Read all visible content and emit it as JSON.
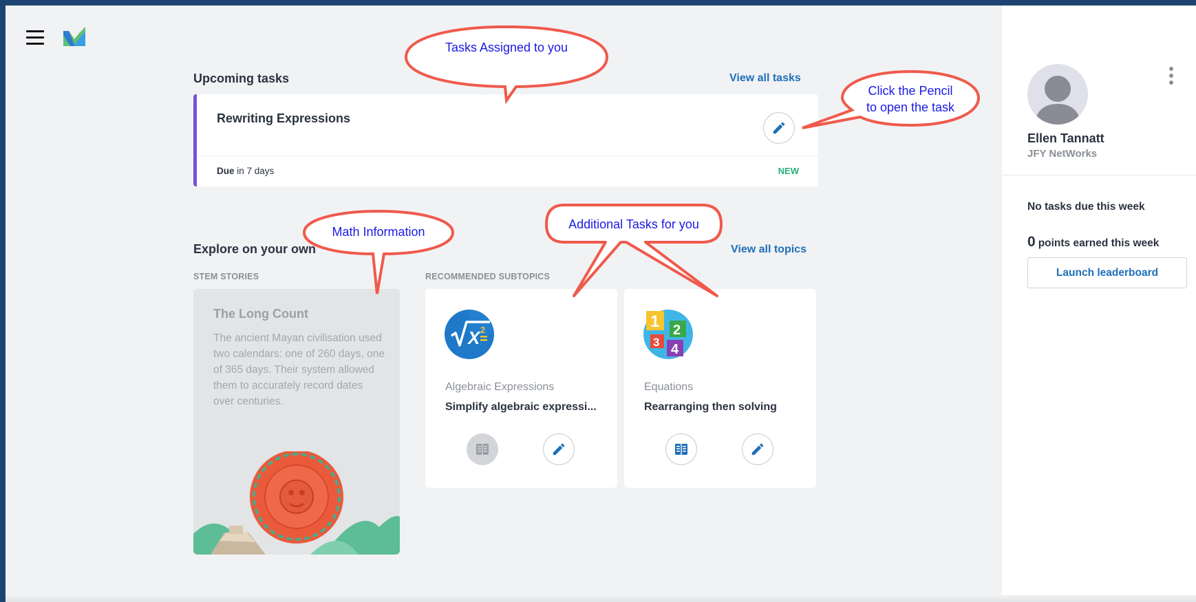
{
  "upcoming": {
    "title": "Upcoming tasks",
    "view_all": "View all tasks",
    "task": {
      "name": "Rewriting Expressions",
      "due_prefix": "Due",
      "due_rest": " in 7 days",
      "badge": "NEW"
    }
  },
  "explore": {
    "title": "Explore on your own",
    "view_all": "View all topics",
    "stem_label": "STEM STORIES",
    "recommended_label": "RECOMMENDED SUBTOPICS",
    "story": {
      "title": "The Long Count",
      "text": "The ancient Mayan civilisation used two calendars: one of 260 days, one of 365 days. Their system allowed them to accurately record dates over centuries."
    },
    "topics": [
      {
        "label": "Algebraic Expressions",
        "title": "Simplify algebraic expressi...",
        "icon": "algebra-x-squared-icon"
      },
      {
        "label": "Equations",
        "title": "Rearranging then solving",
        "icon": "numbered-blocks-icon"
      }
    ]
  },
  "callouts": {
    "tasks_assigned": "Tasks Assigned to you",
    "click_pencil_1": "Click the Pencil",
    "click_pencil_2": "to open the task",
    "math_info": "Math Information",
    "additional_tasks": "Additional Tasks for you"
  },
  "profile": {
    "name": "Ellen Tannatt",
    "org": "JFY NetWorks",
    "no_tasks": "No tasks due this week",
    "points_value": "0",
    "points_label": "points earned this week",
    "leaderboard_button": "Launch leaderboard"
  },
  "colors": {
    "task_accent": "#7a4fd6",
    "link": "#1d6fb8",
    "new_badge": "#29b07a",
    "callout_border": "#ef5a4c",
    "callout_text": "#1a1ae6"
  }
}
